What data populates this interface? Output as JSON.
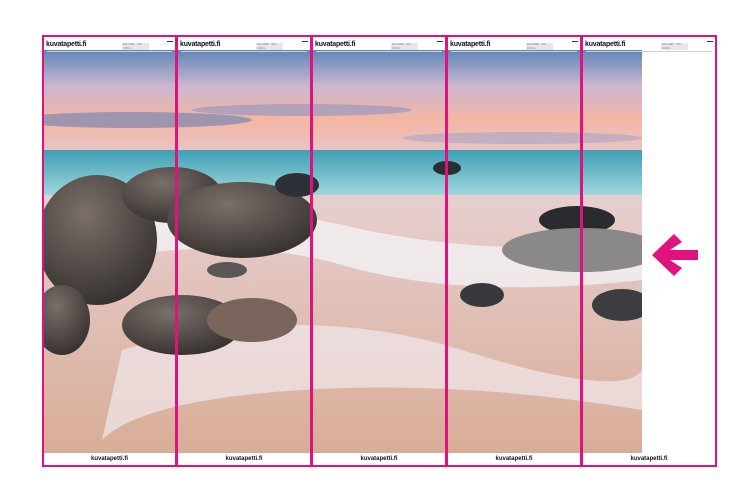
{
  "brand": "kuvatapetti.fi",
  "panel_code": "KU-1232 · 5/5 · 3.00m",
  "footer_label": "kuvatapetti.fi",
  "panels": [
    {
      "number": 1
    },
    {
      "number": 2
    },
    {
      "number": 3
    },
    {
      "number": 4
    },
    {
      "number": 5
    }
  ],
  "colors": {
    "guide": "#e0127d",
    "sky_top": "#5f86b8",
    "sky_glow": "#f3b9a6",
    "sea": "#3f9fb4",
    "sand": "#d8b2a2"
  },
  "icons": {
    "arrow": "arrow-left-icon"
  }
}
